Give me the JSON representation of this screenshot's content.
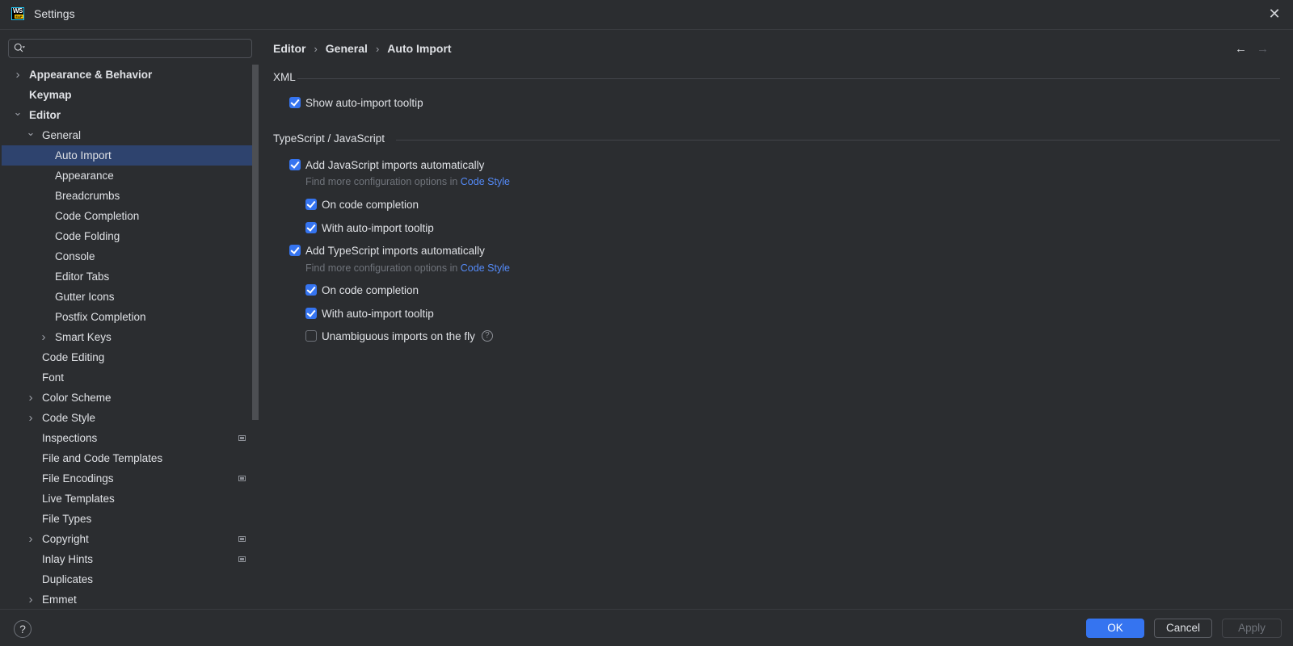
{
  "window": {
    "title": "Settings",
    "logo_text": "WS",
    "logo_badge": "EAP",
    "close_icon": "close-icon"
  },
  "sidebar": {
    "search": {
      "value": "",
      "placeholder": ""
    },
    "items": [
      {
        "label": "Appearance & Behavior",
        "level": 0,
        "expandable": true,
        "expanded": false,
        "bold": true
      },
      {
        "label": "Keymap",
        "level": 0,
        "expandable": false,
        "bold": true
      },
      {
        "label": "Editor",
        "level": 0,
        "expandable": true,
        "expanded": true,
        "bold": true
      },
      {
        "label": "General",
        "level": 1,
        "expandable": true,
        "expanded": true
      },
      {
        "label": "Auto Import",
        "level": 2,
        "selected": true
      },
      {
        "label": "Appearance",
        "level": 2
      },
      {
        "label": "Breadcrumbs",
        "level": 2
      },
      {
        "label": "Code Completion",
        "level": 2
      },
      {
        "label": "Code Folding",
        "level": 2
      },
      {
        "label": "Console",
        "level": 2
      },
      {
        "label": "Editor Tabs",
        "level": 2
      },
      {
        "label": "Gutter Icons",
        "level": 2
      },
      {
        "label": "Postfix Completion",
        "level": 2
      },
      {
        "label": "Smart Keys",
        "level": 2,
        "expandable": true,
        "expanded": false
      },
      {
        "label": "Code Editing",
        "level": 1
      },
      {
        "label": "Font",
        "level": 1
      },
      {
        "label": "Color Scheme",
        "level": 1,
        "expandable": true,
        "expanded": false
      },
      {
        "label": "Code Style",
        "level": 1,
        "expandable": true,
        "expanded": false
      },
      {
        "label": "Inspections",
        "level": 1,
        "project_icon": true
      },
      {
        "label": "File and Code Templates",
        "level": 1
      },
      {
        "label": "File Encodings",
        "level": 1,
        "project_icon": true
      },
      {
        "label": "Live Templates",
        "level": 1
      },
      {
        "label": "File Types",
        "level": 1
      },
      {
        "label": "Copyright",
        "level": 1,
        "expandable": true,
        "expanded": false,
        "project_icon": true
      },
      {
        "label": "Inlay Hints",
        "level": 1,
        "project_icon": true
      },
      {
        "label": "Duplicates",
        "level": 1
      },
      {
        "label": "Emmet",
        "level": 1,
        "expandable": true,
        "expanded": false
      }
    ]
  },
  "main": {
    "breadcrumb": [
      "Editor",
      "General",
      "Auto Import"
    ],
    "breadcrumb_sep": "›",
    "nav_back": "←",
    "nav_forward": "→",
    "sections": {
      "xml": {
        "title": "XML",
        "show_tooltip": {
          "label": "Show auto-import tooltip",
          "checked": true
        }
      },
      "ts_js": {
        "title": "TypeScript / JavaScript",
        "js_auto": {
          "label": "Add JavaScript imports automatically",
          "checked": true
        },
        "js_hint_prefix": "Find more configuration options in ",
        "js_hint_link": "Code Style",
        "js_on_completion": {
          "label": "On code completion",
          "checked": true
        },
        "js_with_tooltip": {
          "label": "With auto-import tooltip",
          "checked": true
        },
        "ts_auto": {
          "label": "Add TypeScript imports automatically",
          "checked": true
        },
        "ts_hint_prefix": "Find more configuration options in ",
        "ts_hint_link": "Code Style",
        "ts_on_completion": {
          "label": "On code completion",
          "checked": true
        },
        "ts_with_tooltip": {
          "label": "With auto-import tooltip",
          "checked": true
        },
        "unambiguous": {
          "label": "Unambiguous imports on the fly",
          "checked": false
        }
      }
    }
  },
  "footer": {
    "help": "?",
    "ok": "OK",
    "cancel": "Cancel",
    "apply": "Apply"
  },
  "colors": {
    "accent": "#3574f0",
    "selection": "#2e436e",
    "link": "#548af7",
    "background": "#2b2d30"
  }
}
